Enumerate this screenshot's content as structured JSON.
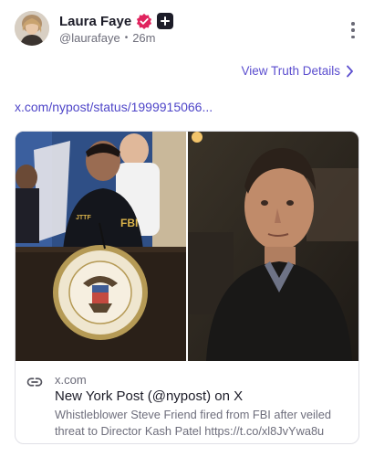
{
  "post": {
    "author": {
      "display_name": "Laura Faye",
      "handle": "@laurafaye",
      "time_ago": "26m",
      "verified_icon": "verified-badge-icon",
      "plus_icon": "plus-badge-icon"
    },
    "view_truth_label": "View Truth Details",
    "link_text": "x.com/nypost/status/1999915066...",
    "card": {
      "domain": "x.com",
      "title": "New York Post (@nypost) on X",
      "description": "Whistleblower Steve Friend fired from FBI after veiled threat to Director Kash Patel https://t.co/xl8JvYwa8u",
      "link_icon": "link-icon"
    }
  },
  "colors": {
    "accent": "#5b4ecf",
    "link": "#4e45c8",
    "verified": "#e0245e",
    "text_primary": "#1c1c28",
    "text_secondary": "#6d6d7a"
  }
}
